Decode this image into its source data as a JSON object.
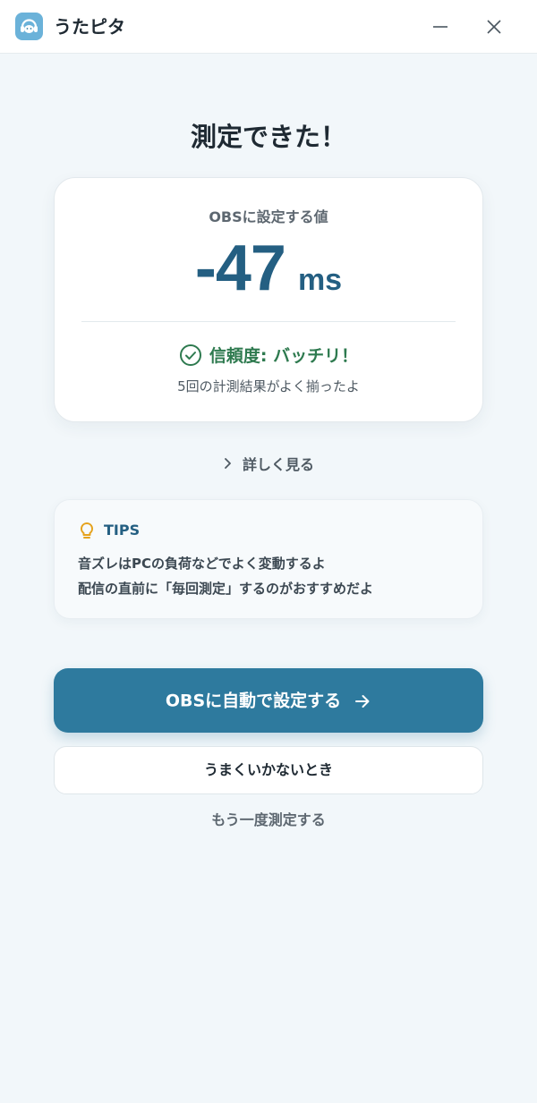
{
  "titlebar": {
    "app_title": "うたピタ",
    "app_icon": "headphone-mascot-icon",
    "minimize_icon": "minimize-icon",
    "close_icon": "close-icon"
  },
  "main": {
    "heading": "測定できた！",
    "result_card": {
      "label": "OBSに設定する値",
      "value": "-47",
      "unit": "ms",
      "reliability": "信頼度: バッチリ！",
      "reliability_sub": "5回の計測結果がよく揃ったよ",
      "reliability_icon": "check-circle-icon"
    },
    "details_link": "詳しく見る",
    "tips": {
      "title": "TIPS",
      "icon": "lightbulb-icon",
      "line1": "音ズレはPCの負荷などでよく変動するよ",
      "line2": "配信の直前に「毎回測定」するのがおすすめだよ"
    },
    "primary_button": "OBSに自動で設定する",
    "secondary_button": "うまくいかないとき",
    "retry_link": "もう一度測定する"
  },
  "colors": {
    "accent": "#2e7a9e",
    "value_text": "#245f82",
    "success": "#2e7a4f",
    "tips_icon": "#e5a21c",
    "background": "#f2f7fa"
  }
}
